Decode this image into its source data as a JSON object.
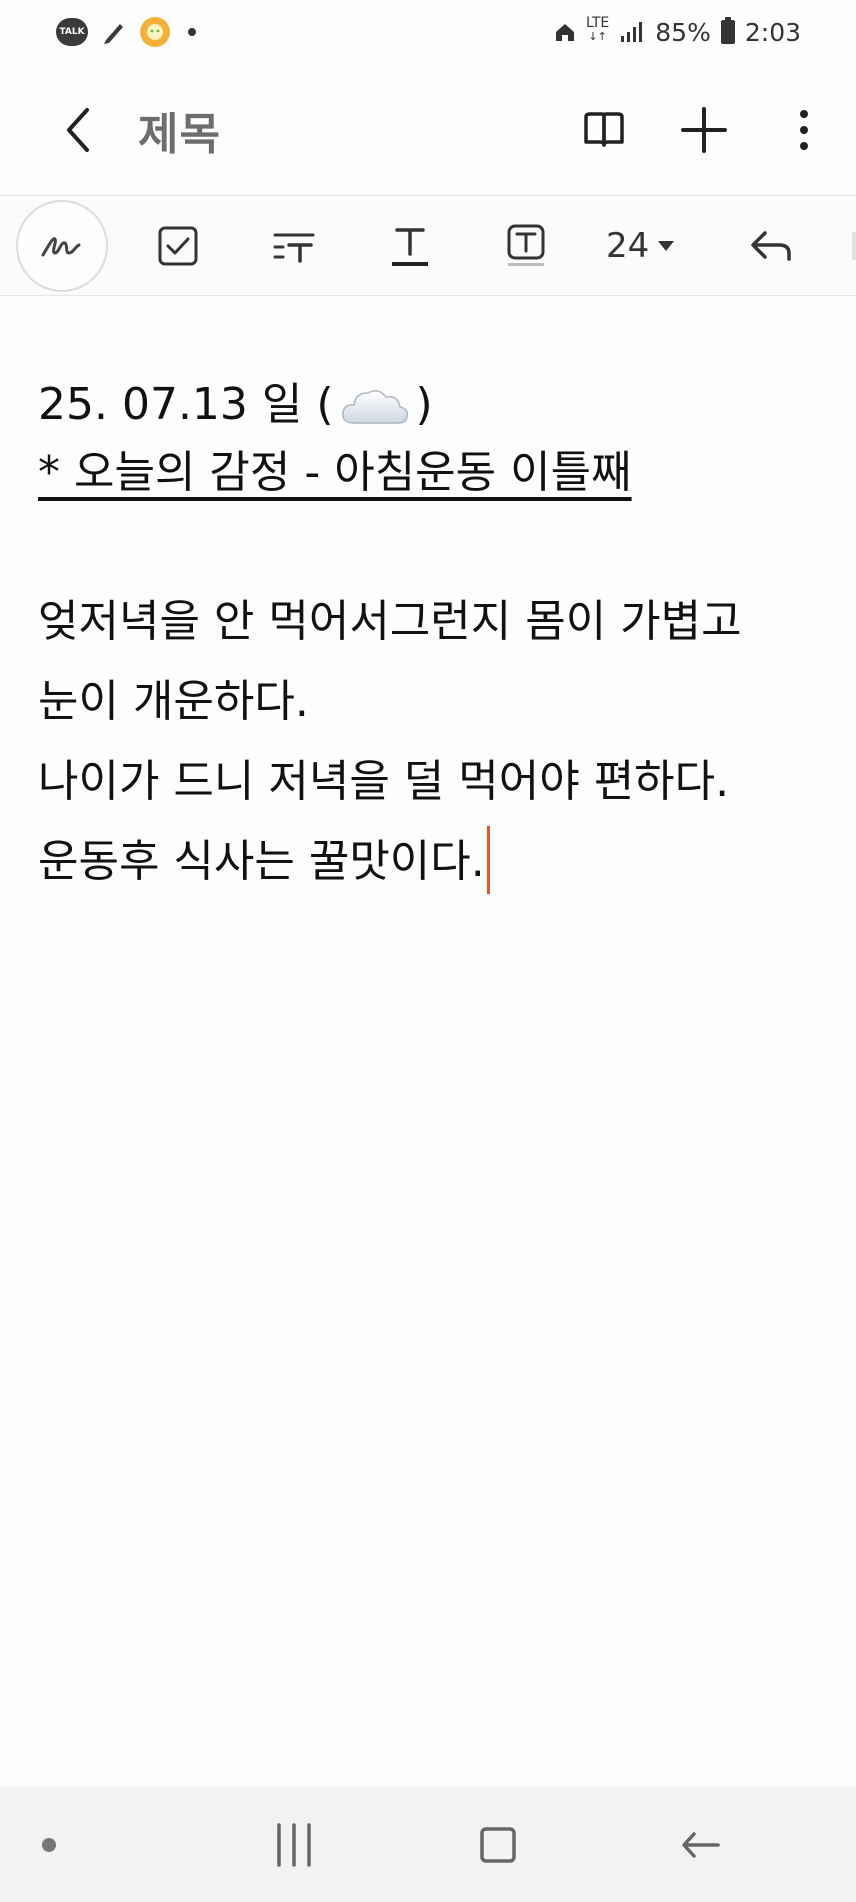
{
  "status_bar": {
    "notif_talk": "TALK",
    "lte_label": "LTE",
    "battery_pct": "85%",
    "time": "2:03"
  },
  "app_bar": {
    "title": "제목",
    "icons": [
      "back-icon",
      "book-view-icon",
      "plus-icon",
      "more-vertical-icon"
    ]
  },
  "toolbar": {
    "font_size": "24",
    "icons": [
      "pen-icon",
      "checkbox-icon",
      "text-style-icon",
      "underline-text-icon",
      "text-box-icon",
      "dropdown-arrow-icon",
      "undo-icon"
    ]
  },
  "note": {
    "date_text_before": "25. 07.13 일 (",
    "date_text_after": ")",
    "emotion_line": "* 오늘의 감정 - 아침운동 이틀째",
    "body_lines": [
      "엊저녁을 안 먹어서그런지 몸이 가볍고",
      "눈이 개운하다.",
      "나이가 드니 저녁을 덜 먹어야 편하다.",
      "운동후 식사는 꿀맛이다."
    ]
  },
  "nav_bar": {
    "icons": [
      "recents-icon",
      "home-icon",
      "back-arrow-icon"
    ]
  },
  "colors": {
    "background": "#fdfdfd",
    "text": "#111111",
    "cursor": "#e05a2a",
    "nav_background": "#f2f2f2"
  }
}
